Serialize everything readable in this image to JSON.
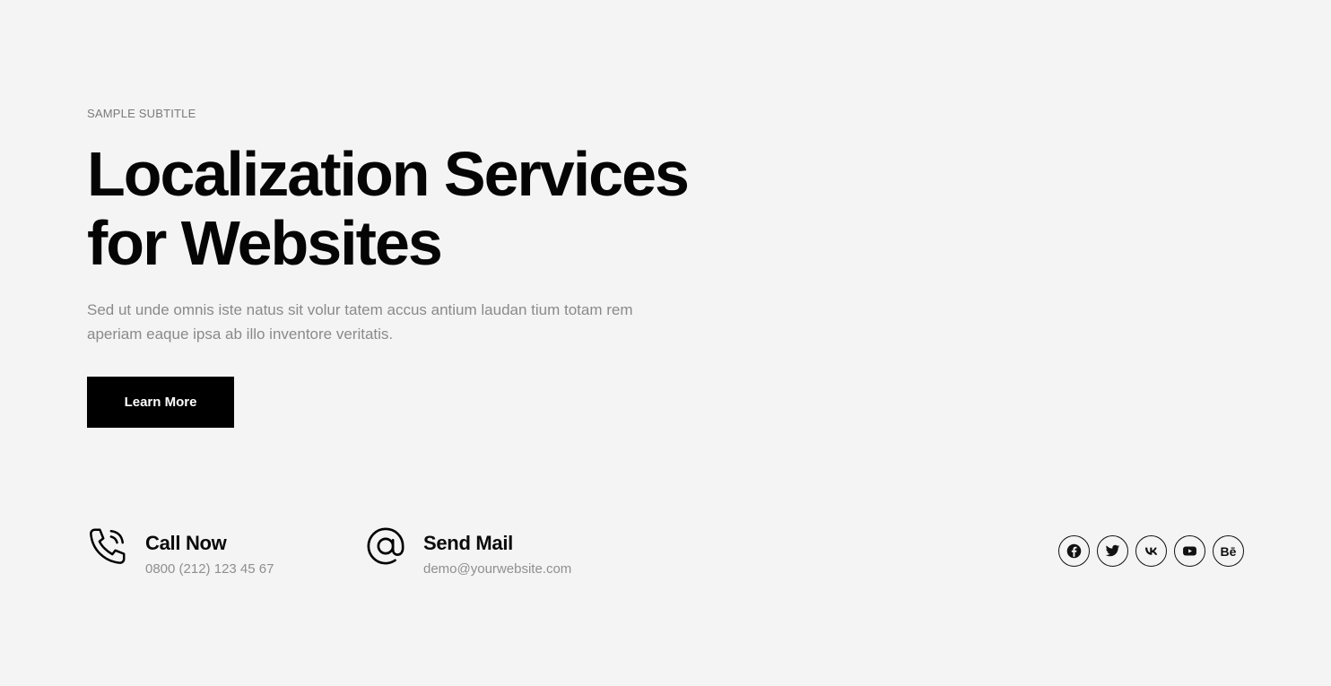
{
  "hero": {
    "subtitle": "SAMPLE SUBTITLE",
    "title_line1": "Localization Services",
    "title_line2": "for Websites",
    "description": "Sed ut unde omnis iste natus sit volur tatem accus antium laudan tium totam rem aperiam eaque ipsa ab illo inventore veritatis.",
    "button_label": "Learn More"
  },
  "contacts": [
    {
      "icon": "phone-icon",
      "label": "Call Now",
      "value": "0800 (212) 123 45 67"
    },
    {
      "icon": "at-sign-icon",
      "label": "Send Mail",
      "value": "demo@yourwebsite.com"
    }
  ],
  "social": [
    {
      "icon": "facebook-icon"
    },
    {
      "icon": "twitter-icon"
    },
    {
      "icon": "vk-icon"
    },
    {
      "icon": "youtube-icon"
    },
    {
      "icon": "behance-icon",
      "text": "Bē"
    }
  ],
  "colors": {
    "background": "#f4f4f4",
    "text": "#0a0a0a",
    "muted": "#8a8a8a",
    "button_bg": "#000000",
    "button_text": "#ffffff"
  }
}
